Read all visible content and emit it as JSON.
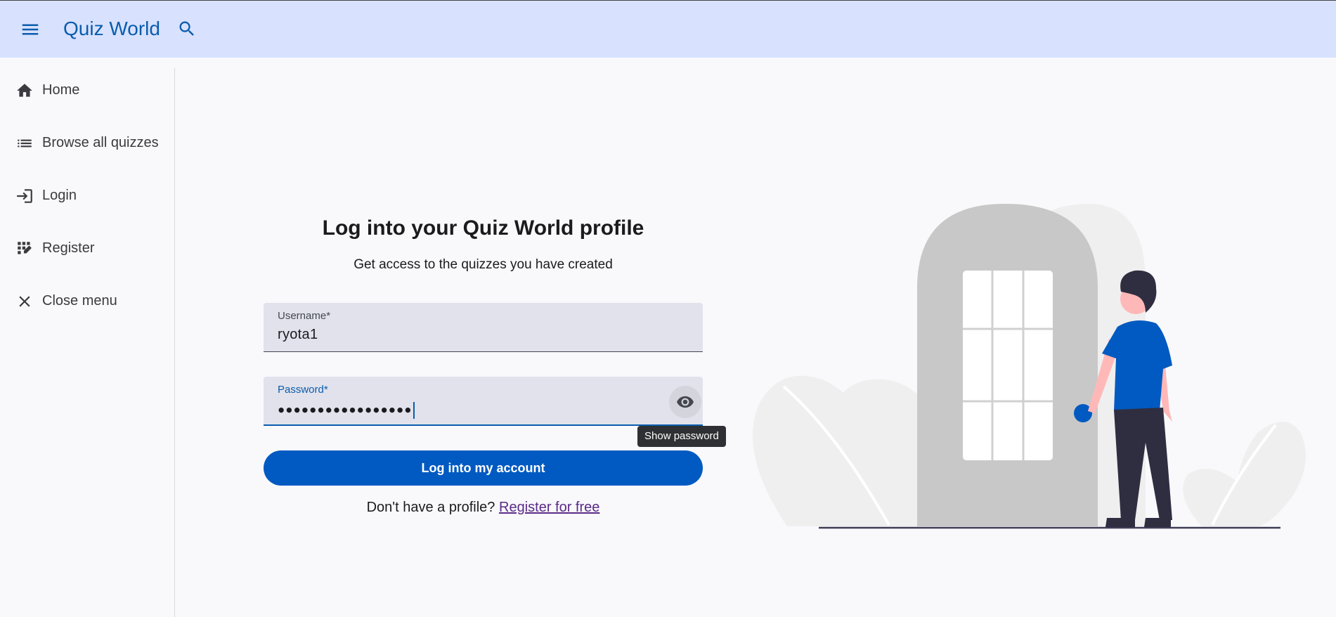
{
  "header": {
    "menu_icon": "menu-icon",
    "title": "Quiz World",
    "search_icon": "search-icon"
  },
  "sidebar": {
    "items": [
      {
        "label": "Home",
        "icon": "home-icon"
      },
      {
        "label": "Browse all quizzes",
        "icon": "list-icon"
      },
      {
        "label": "Login",
        "icon": "login-icon"
      },
      {
        "label": "Register",
        "icon": "register-icon"
      },
      {
        "label": "Close menu",
        "icon": "close-icon"
      }
    ]
  },
  "login": {
    "heading": "Log into your Quiz World profile",
    "subheading": "Get access to the quizzes you have created",
    "username_label": "Username*",
    "username_value": "ryota1",
    "password_label": "Password*",
    "password_value": "●●●●●●●●●●●●●●●●●",
    "show_password_icon": "eye-icon",
    "show_password_tooltip": "Show password",
    "submit_label": "Log into my account",
    "register_prompt": "Don't have a profile?",
    "register_link": "Register for free"
  },
  "colors": {
    "header_bg": "#d8e2ff",
    "brand": "#0b5cad",
    "button": "#005ac1",
    "link": "#5a2a86"
  }
}
